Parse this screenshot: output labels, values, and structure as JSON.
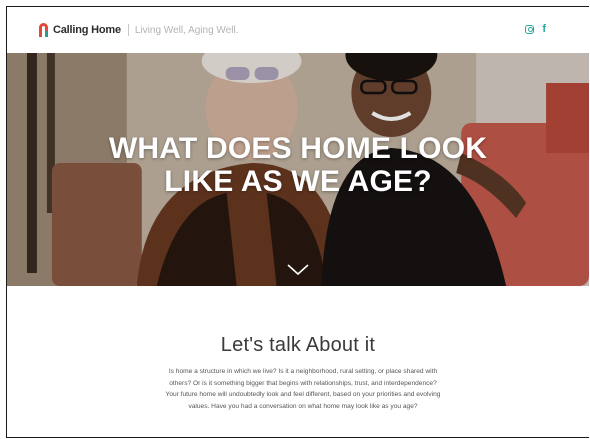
{
  "brand": {
    "name": "Calling Home",
    "tagline": "Living Well, Aging Well."
  },
  "social": {
    "instagram_icon": "instagram-icon",
    "facebook_label": "f",
    "accent_color": "#2aa59a"
  },
  "hero": {
    "title": "WHAT DOES HOME LOOK LIKE AS WE AGE?",
    "scroll_icon": "chevron-down-icon"
  },
  "section": {
    "title": "Let's talk About it",
    "body": "Is home a structure in which we live? Is it a neighborhood, rural setting, or place shared with others? Or is it something bigger that begins with relationships, trust, and interdependence? Your future home will undoubtedly look and feel different, based on your priorities and evolving values. Have you had a conversation on what home may look like as you age?"
  },
  "colors": {
    "logo_red": "#e2493a",
    "logo_teal": "#2a9d8f"
  }
}
